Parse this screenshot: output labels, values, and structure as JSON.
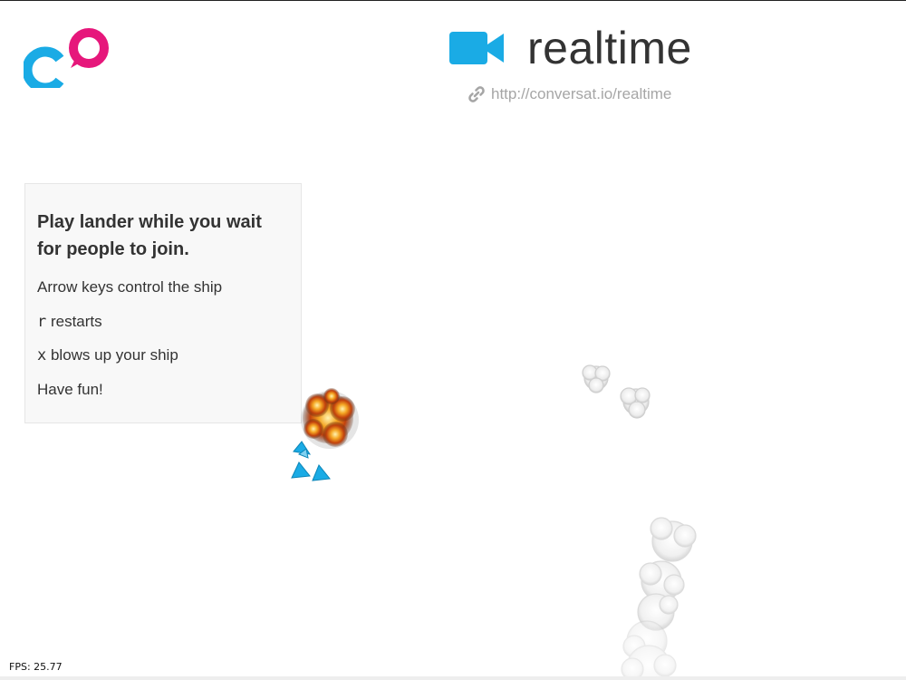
{
  "header": {
    "room_title": "realtime",
    "room_url": "http://conversat.io/realtime"
  },
  "instructions": {
    "heading": "Play lander while you wait for people to join.",
    "line_controls": "Arrow keys control the ship",
    "restart_key": "r",
    "restart_text": " restarts",
    "explode_key": "x",
    "explode_text": " blows up your ship",
    "closing": "Have fun!"
  },
  "game": {
    "fps_label": "FPS: 25.77"
  },
  "colors": {
    "logo_blue": "#1aabe5",
    "logo_pink": "#e6177b",
    "camera_blue": "#1aabe5",
    "title_text": "#333333",
    "link_text": "#a6a6a6",
    "panel_bg": "#f8f8f8"
  },
  "icons": {
    "logo": "conversat-logo",
    "camera": "video-camera-icon",
    "link": "chain-link-icon"
  }
}
